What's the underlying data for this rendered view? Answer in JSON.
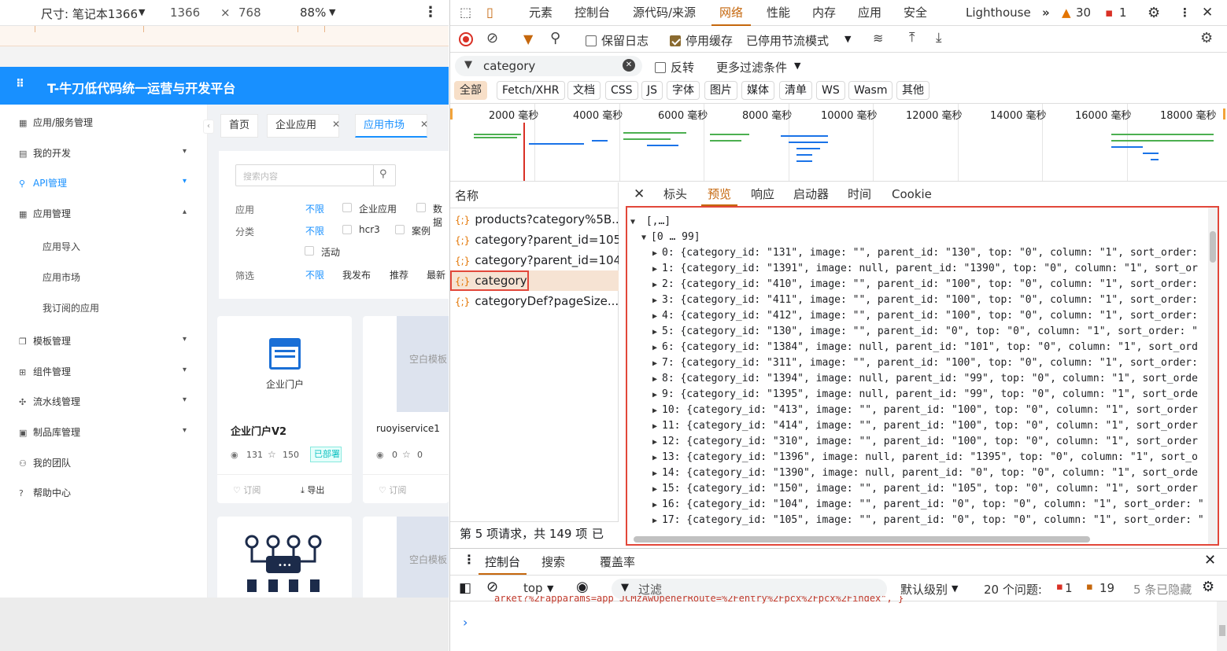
{
  "device_toolbar": {
    "dimensions_label": "尺寸: 笔记本1366",
    "width": "1366",
    "times": "×",
    "height": "768",
    "zoom": "88%",
    "more": "⋮"
  },
  "site": {
    "title": "T-牛刀低代码统一运营与开发平台",
    "sidebar": [
      {
        "label": "应用/服务管理",
        "icon": "grid-icon",
        "chevron": ""
      },
      {
        "label": "我的开发",
        "icon": "dev-icon",
        "chevron": "⌄"
      },
      {
        "label": "API管理",
        "icon": "link-icon",
        "chevron": "⌄",
        "active": true
      },
      {
        "label": "应用管理",
        "icon": "app-icon",
        "chevron": "⌃"
      }
    ],
    "sub_items": [
      "应用导入",
      "应用市场",
      "我订阅的应用"
    ],
    "sidebar_more": [
      {
        "label": "模板管理",
        "chevron": "⌄"
      },
      {
        "label": "组件管理",
        "chevron": "⌄"
      },
      {
        "label": "流水线管理",
        "chevron": "⌄"
      },
      {
        "label": "制品库管理",
        "chevron": "⌄"
      },
      {
        "label": "我的团队",
        "chevron": ""
      },
      {
        "label": "帮助中心",
        "chevron": ""
      }
    ],
    "tabs": [
      "首页",
      "企业应用",
      "应用市场"
    ],
    "search_placeholder": "搜索内容",
    "filter_rows": [
      {
        "label": "应用",
        "options": [
          "不限",
          "企业应用",
          "数据"
        ]
      },
      {
        "label": "分类",
        "options": [
          "不限",
          "hcr3",
          "案例",
          "活动"
        ]
      },
      {
        "label": "筛选",
        "options": [
          "不限",
          "我发布",
          "推荐",
          "最新"
        ]
      }
    ],
    "cards": [
      {
        "icon_label": "企业门户",
        "title": "企业门户V2",
        "views": "131",
        "stars": "150",
        "badge": "已部署",
        "subscribe": "订阅",
        "export": "导出"
      },
      {
        "icon_label": "空白模板",
        "title": "ruoyiservice1",
        "views": "0",
        "stars": "0",
        "subscribe": "订阅"
      },
      {
        "icon_label": "",
        "title": ""
      },
      {
        "icon_label": "空白模板",
        "title": ""
      }
    ]
  },
  "devtools": {
    "tabs": [
      "元素",
      "控制台",
      "源代码/来源",
      "网络",
      "性能",
      "内存",
      "应用",
      "安全",
      "Lighthouse"
    ],
    "active_tab": "网络",
    "warnings": "30",
    "errors": "1",
    "preserve_log": "保留日志",
    "disable_cache": "停用缓存",
    "throttle": "已停用节流模式",
    "filter_value": "category",
    "invert": "反转",
    "more_filters": "更多过滤条件",
    "type_filters": [
      "全部",
      "Fetch/XHR",
      "文档",
      "CSS",
      "JS",
      "字体",
      "图片",
      "媒体",
      "清单",
      "WS",
      "Wasm",
      "其他"
    ],
    "timeline_labels": [
      "2000 毫秒",
      "4000 毫秒",
      "6000 毫秒",
      "8000 毫秒",
      "10000 毫秒",
      "12000 毫秒",
      "14000 毫秒",
      "16000 毫秒",
      "18000 毫秒"
    ],
    "name_header": "名称",
    "requests": [
      "products?category%5B...",
      "category?parent_id=105",
      "category?parent_id=104",
      "category",
      "categoryDef?pageSize..."
    ],
    "selected_request": "category",
    "detail_tabs": [
      "标头",
      "预览",
      "响应",
      "启动器",
      "时间",
      "Cookie"
    ],
    "active_detail_tab": "预览",
    "status_text": "第 5 项请求，共 149 项",
    "status_trunc": "已",
    "json_root": "[,…]",
    "json_group": "[0 … 99]",
    "json_rows": [
      "0: {category_id: \"131\", image: \"\", parent_id: \"130\", top: \"0\", column: \"1\", sort_order:",
      "1: {category_id: \"1391\", image: null, parent_id: \"1390\", top: \"0\", column: \"1\", sort_or",
      "2: {category_id: \"410\", image: \"\", parent_id: \"100\", top: \"0\", column: \"1\", sort_order:",
      "3: {category_id: \"411\", image: \"\", parent_id: \"100\", top: \"0\", column: \"1\", sort_order:",
      "4: {category_id: \"412\", image: \"\", parent_id: \"100\", top: \"0\", column: \"1\", sort_order:",
      "5: {category_id: \"130\", image: \"\", parent_id: \"0\", top: \"0\", column: \"1\", sort_order: \"",
      "6: {category_id: \"1384\", image: null, parent_id: \"101\", top: \"0\", column: \"1\", sort_ord",
      "7: {category_id: \"311\", image: \"\", parent_id: \"100\", top: \"0\", column: \"1\", sort_order:",
      "8: {category_id: \"1394\", image: null, parent_id: \"99\", top: \"0\", column: \"1\", sort_orde",
      "9: {category_id: \"1395\", image: null, parent_id: \"99\", top: \"0\", column: \"1\", sort_orde",
      "10: {category_id: \"413\", image: \"\", parent_id: \"100\", top: \"0\", column: \"1\", sort_order",
      "11: {category_id: \"414\", image: \"\", parent_id: \"100\", top: \"0\", column: \"1\", sort_order",
      "12: {category_id: \"310\", image: \"\", parent_id: \"100\", top: \"0\", column: \"1\", sort_order",
      "13: {category_id: \"1396\", image: null, parent_id: \"1395\", top: \"0\", column: \"1\", sort_o",
      "14: {category_id: \"1390\", image: null, parent_id: \"0\", top: \"0\", column: \"1\", sort_orde",
      "15: {category_id: \"150\", image: \"\", parent_id: \"105\", top: \"0\", column: \"1\", sort_order",
      "16: {category_id: \"104\", image: \"\", parent_id: \"0\", top: \"0\", column: \"1\", sort_order: \"",
      "17: {category_id: \"105\", image: \"\", parent_id: \"0\", top: \"0\", column: \"1\", sort_order: \""
    ],
    "drawer": {
      "tabs": [
        "控制台",
        "搜索",
        "覆盖率"
      ],
      "context": "top",
      "filter_placeholder": "过滤",
      "level": "默认级别",
      "issues_label": "20 个问题:",
      "issues_err": "1",
      "issues_info": "19",
      "hidden": "5 条已隐藏",
      "console_line": "arket?%2Fapparams=app  JCMzAwOpenerRoute=%2Fentry%2Fpcx%2Fpcx%2Findex\",     }",
      "prompt": "›"
    }
  },
  "colors": {
    "accent": "#1890ff",
    "devtools_active": "#c5670d",
    "highlight": "#e2473a"
  }
}
